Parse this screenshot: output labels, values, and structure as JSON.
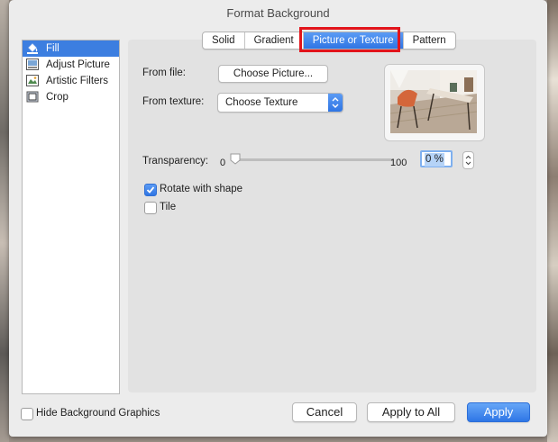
{
  "window": {
    "title": "Format Background"
  },
  "sidebar": {
    "items": [
      {
        "label": "Fill",
        "icon": "paint-bucket-icon",
        "selected": true
      },
      {
        "label": "Adjust Picture",
        "icon": "adjust-picture-icon",
        "selected": false
      },
      {
        "label": "Artistic Filters",
        "icon": "artistic-filters-icon",
        "selected": false
      },
      {
        "label": "Crop",
        "icon": "crop-icon",
        "selected": false
      }
    ]
  },
  "tabs": [
    {
      "label": "Solid",
      "active": false
    },
    {
      "label": "Gradient",
      "active": false
    },
    {
      "label": "Picture or Texture",
      "active": true
    },
    {
      "label": "Pattern",
      "active": false
    }
  ],
  "fill": {
    "from_file_label": "From file:",
    "choose_picture_button": "Choose Picture...",
    "from_texture_label": "From texture:",
    "texture_select_value": "Choose Texture",
    "transparency_label": "Transparency:",
    "slider_min": "0",
    "slider_max": "100",
    "transparency_value": "0 %",
    "transparency_fraction": 0,
    "rotate_label": "Rotate with shape",
    "rotate_checked": true,
    "tile_label": "Tile",
    "tile_checked": false
  },
  "footer": {
    "hide_bg_label": "Hide Background Graphics",
    "hide_bg_checked": false,
    "cancel": "Cancel",
    "apply_all": "Apply to All",
    "apply": "Apply"
  },
  "colors": {
    "accent": "#3c7ee0",
    "highlight": "#e2141b"
  }
}
